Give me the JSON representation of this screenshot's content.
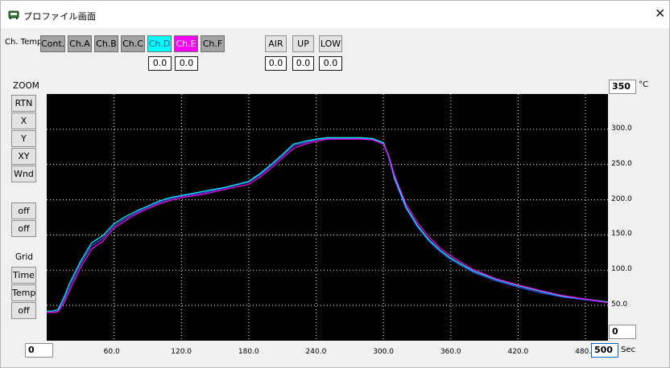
{
  "window": {
    "title": "プロファイル画面",
    "close_glyph": "✕"
  },
  "channels": {
    "label": "Ch. Temp.",
    "buttons": [
      {
        "label": "Cont.",
        "style": "dark"
      },
      {
        "label": "Ch.A",
        "style": "dark"
      },
      {
        "label": "Ch.B",
        "style": "dark"
      },
      {
        "label": "Ch.C",
        "style": "dark"
      },
      {
        "label": "Ch.D",
        "style": "cyan"
      },
      {
        "label": "Ch.E",
        "style": "magenta"
      },
      {
        "label": "Ch.F",
        "style": "dark"
      }
    ],
    "values": [
      "0.0",
      "0.0"
    ]
  },
  "env": {
    "buttons": [
      "AIR",
      "UP",
      "LOW"
    ],
    "values": [
      "0.0",
      "0.0",
      "0.0"
    ]
  },
  "zoom": {
    "label": "ZOOM",
    "buttons": [
      "RTN",
      "X",
      "Y",
      "XY",
      "Wnd"
    ]
  },
  "toggles": [
    "off",
    "off"
  ],
  "grid": {
    "label": "Grid",
    "buttons": [
      "Time",
      "Temp",
      "off"
    ]
  },
  "axis": {
    "y_max_value": "350",
    "y_unit": "°C",
    "y_min_value": "0",
    "x_min_value": "0",
    "x_max_value": "500",
    "x_unit": "Sec"
  },
  "colors": {
    "plot_bg": "#000000",
    "grid": "#ffffff",
    "series_d": "#00ffff",
    "series_e": "#ff00ff",
    "series_base": "#3355ff"
  },
  "chart_data": {
    "type": "line",
    "xlabel": "",
    "ylabel": "",
    "xlim": [
      0,
      500
    ],
    "ylim": [
      0,
      350
    ],
    "x_ticks": [
      "60.0",
      "120.0",
      "180.0",
      "240.0",
      "300.0",
      "360.0",
      "420.0",
      "480.0"
    ],
    "y_ticks": [
      "300.0",
      "250.0",
      "200.0",
      "150.0",
      "100.0",
      "50.0"
    ],
    "grid": true,
    "series": [
      {
        "color": "#3355ff",
        "x": [
          0,
          5,
          10,
          15,
          20,
          30,
          40,
          50,
          60,
          70,
          80,
          90,
          100,
          110,
          120,
          140,
          160,
          180,
          190,
          200,
          210,
          220,
          230,
          240,
          250,
          260,
          270,
          280,
          290,
          300,
          305,
          310,
          320,
          330,
          340,
          350,
          360,
          380,
          400,
          420,
          440,
          460,
          480,
          500
        ],
        "y": [
          40,
          40,
          42,
          56,
          75,
          108,
          135,
          145,
          163,
          173,
          182,
          189,
          196,
          201,
          205,
          210,
          217,
          225,
          235,
          248,
          262,
          277,
          281,
          285,
          287,
          287,
          287,
          287,
          286,
          280,
          258,
          228,
          188,
          162,
          142,
          127,
          115,
          97,
          85,
          76,
          68,
          62,
          58,
          54
        ]
      },
      {
        "color": "#00ffff",
        "x": [
          0,
          5,
          10,
          15,
          20,
          30,
          40,
          50,
          60,
          70,
          80,
          90,
          100,
          110,
          120,
          140,
          160,
          180,
          190,
          200,
          210,
          220,
          230,
          240,
          250,
          260,
          270,
          280,
          290,
          300,
          305,
          310,
          320,
          330,
          340,
          350,
          360,
          380,
          400,
          420,
          440,
          460,
          480,
          500
        ],
        "y": [
          42,
          42,
          44,
          60,
          80,
          112,
          139,
          149,
          166,
          176,
          184,
          191,
          198,
          203,
          206,
          212,
          218,
          226,
          237,
          250,
          264,
          279,
          283,
          286,
          288,
          288,
          288,
          288,
          287,
          281,
          260,
          231,
          190,
          164,
          144,
          129,
          117,
          99,
          87,
          78,
          70,
          63,
          59,
          55
        ]
      },
      {
        "color": "#ff00ff",
        "x": [
          0,
          5,
          10,
          15,
          20,
          30,
          40,
          50,
          60,
          70,
          80,
          90,
          100,
          110,
          120,
          140,
          160,
          180,
          190,
          200,
          210,
          220,
          230,
          240,
          250,
          260,
          270,
          280,
          290,
          300,
          305,
          310,
          320,
          330,
          340,
          350,
          360,
          380,
          400,
          420,
          440,
          460,
          480,
          500
        ],
        "y": [
          40,
          40,
          41,
          52,
          70,
          103,
          130,
          141,
          160,
          170,
          180,
          187,
          194,
          199,
          203,
          208,
          215,
          222,
          232,
          245,
          259,
          273,
          279,
          283,
          286,
          286,
          286,
          286,
          285,
          279,
          261,
          234,
          194,
          168,
          148,
          132,
          120,
          101,
          88,
          79,
          71,
          64,
          59,
          54
        ]
      }
    ]
  }
}
